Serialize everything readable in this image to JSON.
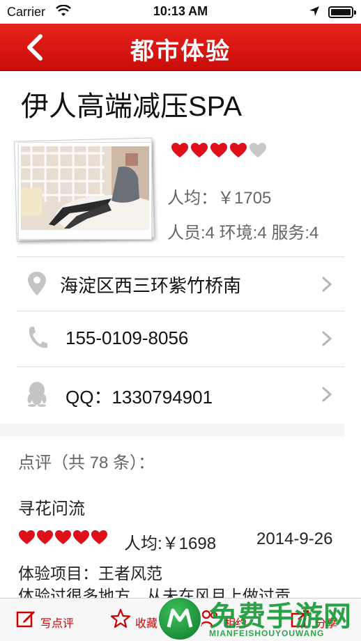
{
  "status_bar": {
    "carrier": "Carrier",
    "time": "10:13 AM"
  },
  "nav": {
    "title": "都市体验",
    "back_icon": "chevron-left-icon"
  },
  "shop": {
    "name": "伊人高端减压SPA",
    "rating_hearts": 4,
    "rating_max": 5,
    "avg_price": "人均：￥1705",
    "scores": "人员:4  环境:4  服务:4"
  },
  "info": {
    "address": "海淀区西三环紫竹桥南",
    "phone": "155-0109-8056",
    "qq": "QQ：1330794901"
  },
  "reviews": {
    "count_label": "点评（共 78 条）：",
    "items": [
      {
        "user": "寻花问流",
        "hearts": 5,
        "avg": "人均:￥1698",
        "date": "2014-9-26",
        "item": "体验项目：王者风范",
        "text": "体验过很多地方，从未在风月上做过贡"
      }
    ]
  },
  "tab_bar": {
    "write_review": "写点评",
    "favorite": "收藏",
    "meet": "相约",
    "share": "分享"
  },
  "watermark": {
    "big": "免费手游网",
    "small": "MIANFEISHOUYOUWANG"
  },
  "colors": {
    "brand_red": "#d6140f",
    "heart_red": "#e0101a",
    "heart_empty": "#c8c8c8"
  }
}
